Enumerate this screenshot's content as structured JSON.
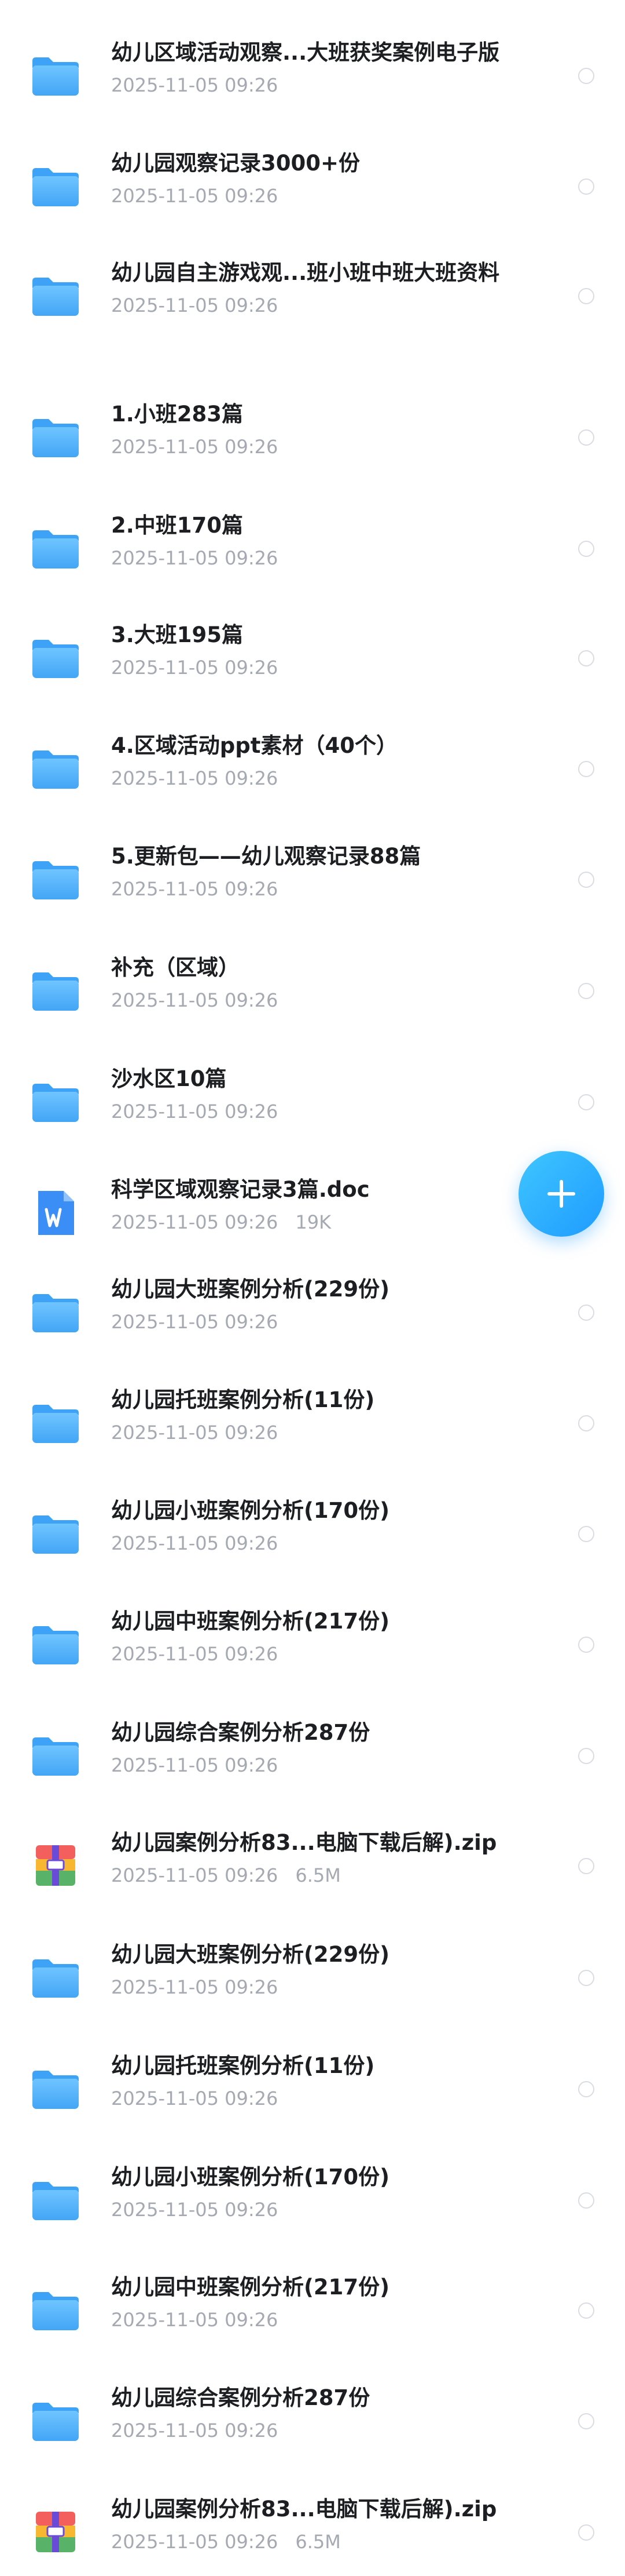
{
  "colors": {
    "folder_light": "#8ed3ff",
    "folder_dark": "#3ea3f7",
    "doc_blue": "#3a8ef6",
    "fab_blue": "#2aa8ff",
    "title_text": "#1c1e22",
    "meta_text": "#a5a9b1"
  },
  "fab": {
    "icon": "plus-icon"
  },
  "files": [
    {
      "type": "folder",
      "icon": "folder-icon",
      "name": "幼儿区域活动观察...大班获奖案例电子版",
      "date": "2025-11-05 09:26",
      "size": ""
    },
    {
      "type": "folder",
      "icon": "folder-icon",
      "name": "幼儿园观察记录3000+份",
      "date": "2025-11-05 09:26",
      "size": ""
    },
    {
      "type": "folder",
      "icon": "folder-icon",
      "name": "幼儿园自主游戏观...班小班中班大班资料",
      "date": "2025-11-05 09:26",
      "size": ""
    },
    {
      "type": "folder",
      "icon": "folder-icon",
      "name": "1.小班283篇",
      "date": "2025-11-05 09:26",
      "size": ""
    },
    {
      "type": "folder",
      "icon": "folder-icon",
      "name": "2.中班170篇",
      "date": "2025-11-05 09:26",
      "size": ""
    },
    {
      "type": "folder",
      "icon": "folder-icon",
      "name": "3.大班195篇",
      "date": "2025-11-05 09:26",
      "size": ""
    },
    {
      "type": "folder",
      "icon": "folder-icon",
      "name": "4.区域活动ppt素材（40个）",
      "date": "2025-11-05 09:26",
      "size": ""
    },
    {
      "type": "folder",
      "icon": "folder-icon",
      "name": "5.更新包——幼儿观察记录88篇",
      "date": "2025-11-05 09:26",
      "size": ""
    },
    {
      "type": "folder",
      "icon": "folder-icon",
      "name": "补充（区域）",
      "date": "2025-11-05 09:26",
      "size": ""
    },
    {
      "type": "folder",
      "icon": "folder-icon",
      "name": "沙水区10篇",
      "date": "2025-11-05 09:26",
      "size": ""
    },
    {
      "type": "doc",
      "icon": "word-document-icon",
      "name": "科学区域观察记录3篇.doc",
      "date": "2025-11-05 09:26",
      "size": "19K"
    },
    {
      "type": "folder",
      "icon": "folder-icon",
      "name": "幼儿园大班案例分析(229份)",
      "date": "2025-11-05 09:26",
      "size": ""
    },
    {
      "type": "folder",
      "icon": "folder-icon",
      "name": "幼儿园托班案例分析(11份)",
      "date": "2025-11-05 09:26",
      "size": ""
    },
    {
      "type": "folder",
      "icon": "folder-icon",
      "name": "幼儿园小班案例分析(170份)",
      "date": "2025-11-05 09:26",
      "size": ""
    },
    {
      "type": "folder",
      "icon": "folder-icon",
      "name": "幼儿园中班案例分析(217份)",
      "date": "2025-11-05 09:26",
      "size": ""
    },
    {
      "type": "folder",
      "icon": "folder-icon",
      "name": "幼儿园综合案例分析287份",
      "date": "2025-11-05 09:26",
      "size": ""
    },
    {
      "type": "zip",
      "icon": "zip-archive-icon",
      "name": "幼儿园案例分析83...电脑下载后解).zip",
      "date": "2025-11-05 09:26",
      "size": "6.5M"
    },
    {
      "type": "folder",
      "icon": "folder-icon",
      "name": "幼儿园大班案例分析(229份)",
      "date": "2025-11-05 09:26",
      "size": ""
    },
    {
      "type": "folder",
      "icon": "folder-icon",
      "name": "幼儿园托班案例分析(11份)",
      "date": "2025-11-05 09:26",
      "size": ""
    },
    {
      "type": "folder",
      "icon": "folder-icon",
      "name": "幼儿园小班案例分析(170份)",
      "date": "2025-11-05 09:26",
      "size": ""
    },
    {
      "type": "folder",
      "icon": "folder-icon",
      "name": "幼儿园中班案例分析(217份)",
      "date": "2025-11-05 09:26",
      "size": ""
    },
    {
      "type": "folder",
      "icon": "folder-icon",
      "name": "幼儿园综合案例分析287份",
      "date": "2025-11-05 09:26",
      "size": ""
    },
    {
      "type": "zip",
      "icon": "zip-archive-icon",
      "name": "幼儿园案例分析83...电脑下载后解).zip",
      "date": "2025-11-05 09:26",
      "size": "6.5M"
    }
  ]
}
